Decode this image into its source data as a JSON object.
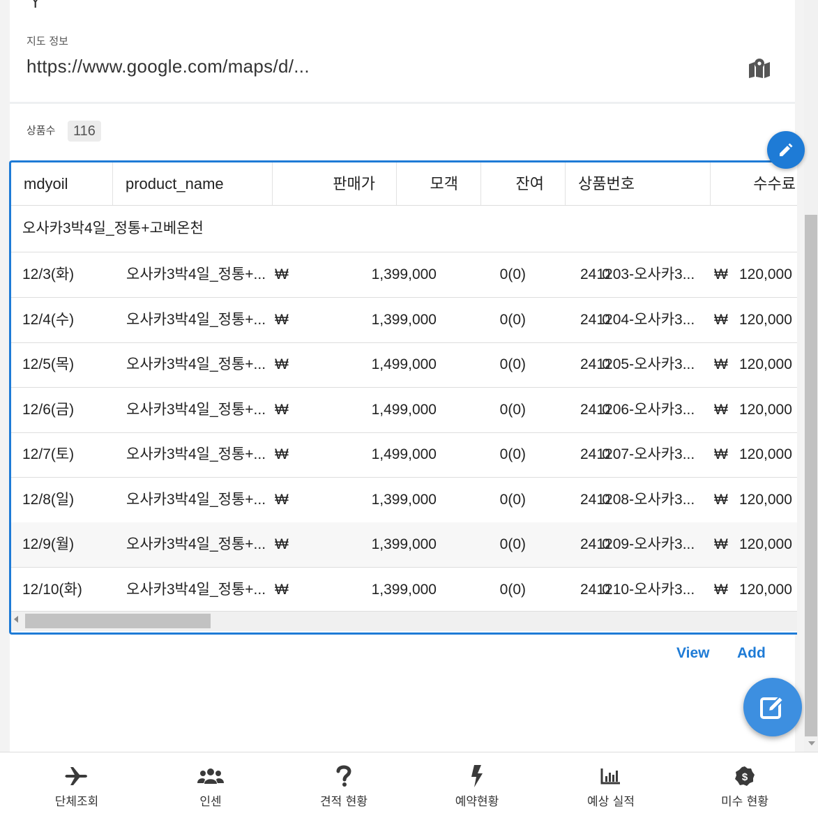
{
  "top": {
    "y_value": "Y",
    "map_label": "지도 정보",
    "map_url": "https://www.google.com/maps/d/..."
  },
  "product_count": {
    "label": "상품수",
    "value": "116"
  },
  "table": {
    "headers": [
      "mdyoil",
      "product_name",
      "판매가",
      "모객",
      "잔여",
      "상품번호",
      "수수료"
    ],
    "group_title": "오사카3박4일_정통+고베온천",
    "currency_symbol": "₩",
    "rows": [
      {
        "date": "12/3(화)",
        "name": "오사카3박4일_정통+...",
        "price": "1,399,000",
        "pax": "0(0)",
        "remain": "0",
        "code": "241203-오사카3...",
        "fee": "120,000"
      },
      {
        "date": "12/4(수)",
        "name": "오사카3박4일_정통+...",
        "price": "1,399,000",
        "pax": "0(0)",
        "remain": "0",
        "code": "241204-오사카3...",
        "fee": "120,000"
      },
      {
        "date": "12/5(목)",
        "name": "오사카3박4일_정통+...",
        "price": "1,499,000",
        "pax": "0(0)",
        "remain": "0",
        "code": "241205-오사카3...",
        "fee": "120,000"
      },
      {
        "date": "12/6(금)",
        "name": "오사카3박4일_정통+...",
        "price": "1,499,000",
        "pax": "0(0)",
        "remain": "0",
        "code": "241206-오사카3...",
        "fee": "120,000"
      },
      {
        "date": "12/7(토)",
        "name": "오사카3박4일_정통+...",
        "price": "1,499,000",
        "pax": "0(0)",
        "remain": "0",
        "code": "241207-오사카3...",
        "fee": "120,000"
      },
      {
        "date": "12/8(일)",
        "name": "오사카3박4일_정통+...",
        "price": "1,399,000",
        "pax": "0(0)",
        "remain": "0",
        "code": "241208-오사카3...",
        "fee": "120,000"
      },
      {
        "date": "12/9(월)",
        "name": "오사카3박4일_정통+...",
        "price": "1,399,000",
        "pax": "0(0)",
        "remain": "0",
        "code": "241209-오사카3...",
        "fee": "120,000"
      },
      {
        "date": "12/10(화)",
        "name": "오사카3박4일_정통+...",
        "price": "1,399,000",
        "pax": "0(0)",
        "remain": "0",
        "code": "241210-오사카3...",
        "fee": "120,000"
      }
    ]
  },
  "actions": {
    "view": "View",
    "add": "Add"
  },
  "nav": [
    {
      "label": "단체조회",
      "icon": "airplane-icon"
    },
    {
      "label": "인센",
      "icon": "users-icon"
    },
    {
      "label": "견적 현황",
      "icon": "question-icon"
    },
    {
      "label": "예약현황",
      "icon": "bolt-icon"
    },
    {
      "label": "예상 실적",
      "icon": "bar-chart-icon"
    },
    {
      "label": "미수 현황",
      "icon": "dollar-badge-icon"
    }
  ],
  "colors": {
    "accent": "#1e7bd6"
  }
}
